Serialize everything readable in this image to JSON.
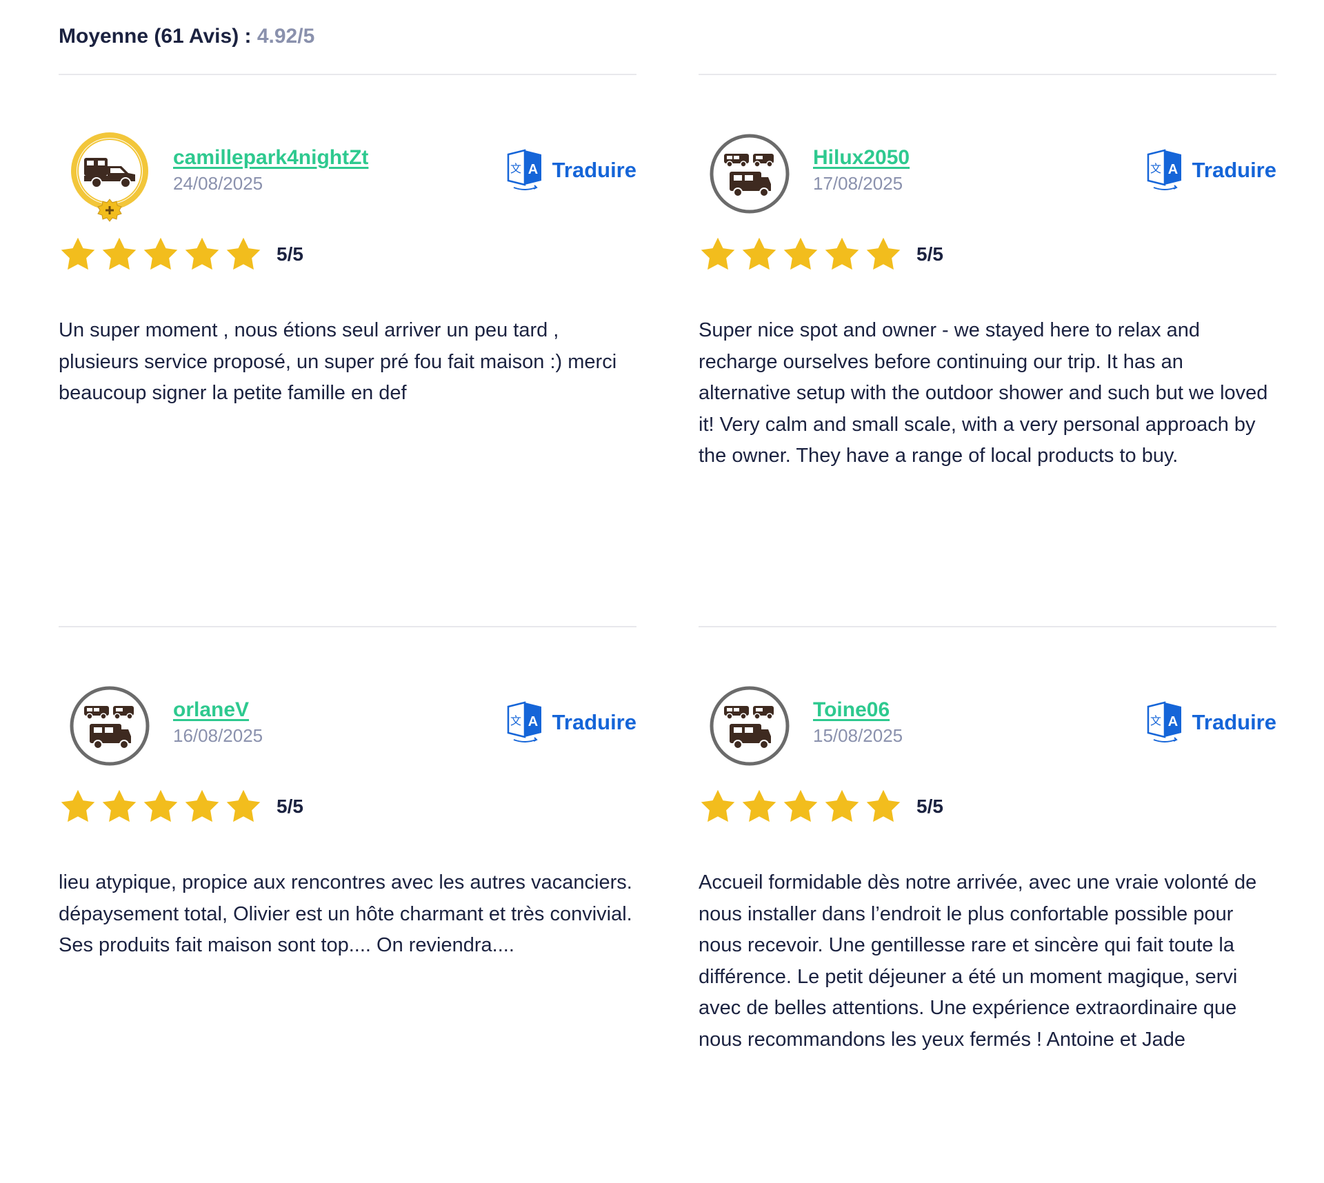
{
  "summary": {
    "label": "Moyenne (61 Avis) : ",
    "score": "4.92/5"
  },
  "translate_label": "Traduire",
  "colors": {
    "username": "#2ec98f",
    "date": "#8a91ad",
    "translate": "#1565d8",
    "star": "#f2bd1d",
    "text": "#1b2240"
  },
  "reviews": [
    {
      "username": "camillepark4nightZt",
      "date": "24/08/2025",
      "avatar": "premium-camper-badge-icon",
      "stars": 5,
      "rating": "5/5",
      "text": "Un super moment , nous étions seul arriver un peu tard , plusieurs service proposé, un super pré fou fait maison :) merci beaucoup signer la petite famille en def"
    },
    {
      "username": "Hilux2050",
      "date": "17/08/2025",
      "avatar": "vehicles-avatar-icon",
      "stars": 5,
      "rating": "5/5",
      "text": "Super nice spot and owner - we stayed here to relax and recharge ourselves before continuing our trip. It has an alternative setup with the outdoor shower and such but we loved it! Very calm and small scale, with a very personal approach by the owner. They have a range of local products to buy."
    },
    {
      "username": "orlaneV",
      "date": "16/08/2025",
      "avatar": "vehicles-avatar-icon",
      "stars": 5,
      "rating": "5/5",
      "text": "lieu atypique, propice aux rencontres avec les autres vacanciers. dépaysement total, Olivier est un hôte charmant et très convivial. Ses produits fait maison sont top.... On reviendra...."
    },
    {
      "username": "Toine06",
      "date": "15/08/2025",
      "avatar": "vehicles-avatar-icon",
      "stars": 5,
      "rating": "5/5",
      "text": "Accueil formidable dès notre arrivée, avec une vraie volonté de nous installer dans l’endroit le plus confortable possible pour nous recevoir. Une gentillesse rare et sincère qui fait toute la différence. Le petit déjeuner a été un moment magique, servi avec de belles attentions. Une expérience extraordinaire que nous recommandons les yeux fermés ! Antoine et Jade"
    }
  ]
}
